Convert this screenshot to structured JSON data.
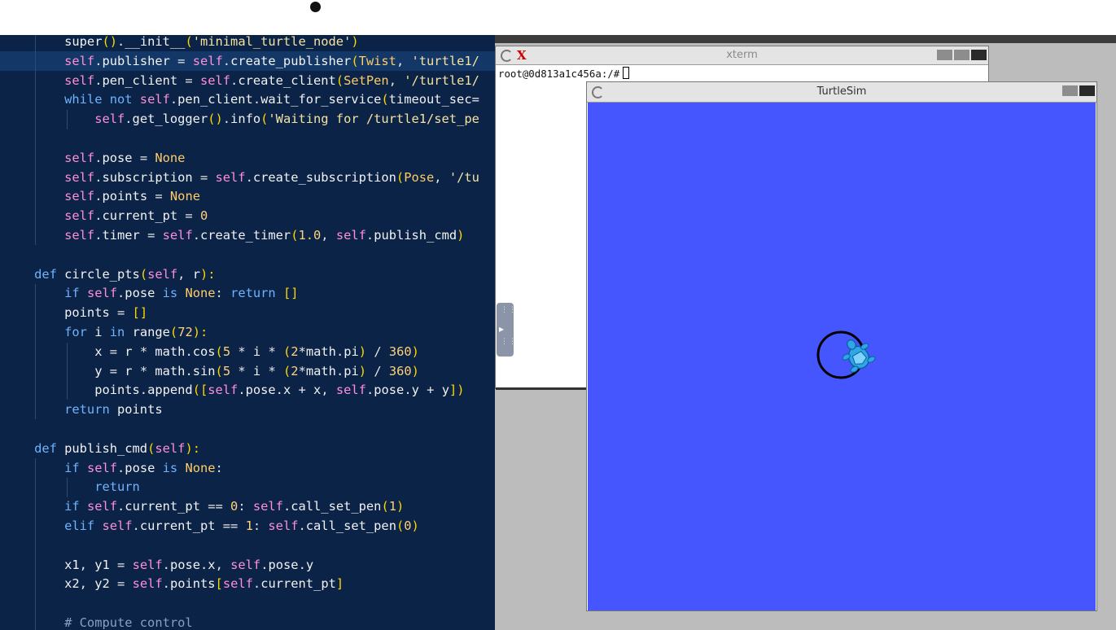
{
  "editor": {
    "lines": [
      [
        [
          "fn",
          "        super"
        ],
        [
          "br",
          "()"
        ],
        [
          "op",
          "."
        ],
        [
          "fn",
          "__init__"
        ],
        [
          "br",
          "("
        ],
        [
          "str",
          "'minimal_turtle_node'"
        ],
        [
          "br",
          ")"
        ]
      ],
      [
        [
          "self",
          "        self"
        ],
        [
          "op",
          "."
        ],
        [
          "fn",
          "publisher "
        ],
        [
          "op",
          "= "
        ],
        [
          "self",
          "self"
        ],
        [
          "op",
          "."
        ],
        [
          "fn",
          "create_publisher"
        ],
        [
          "br",
          "("
        ],
        [
          "cls",
          "Twist"
        ],
        [
          "op",
          ", "
        ],
        [
          "str",
          "'turtle1/"
        ]
      ],
      [
        [
          "self",
          "        self"
        ],
        [
          "op",
          "."
        ],
        [
          "fn",
          "pen_client "
        ],
        [
          "op",
          "= "
        ],
        [
          "self",
          "self"
        ],
        [
          "op",
          "."
        ],
        [
          "fn",
          "create_client"
        ],
        [
          "br",
          "("
        ],
        [
          "cls",
          "SetPen"
        ],
        [
          "op",
          ", "
        ],
        [
          "str",
          "'/turtle1/"
        ]
      ],
      [
        [
          "kw",
          "        while not "
        ],
        [
          "self",
          "self"
        ],
        [
          "op",
          "."
        ],
        [
          "fn",
          "pen_client"
        ],
        [
          "op",
          "."
        ],
        [
          "fn",
          "wait_for_service"
        ],
        [
          "br",
          "("
        ],
        [
          "fn",
          "timeout_sec="
        ]
      ],
      [
        [
          "self",
          "            self"
        ],
        [
          "op",
          "."
        ],
        [
          "fn",
          "get_logger"
        ],
        [
          "br",
          "()"
        ],
        [
          "op",
          "."
        ],
        [
          "fn",
          "info"
        ],
        [
          "br",
          "("
        ],
        [
          "str",
          "'Waiting for /turtle1/set_pe"
        ]
      ],
      [
        [
          "op",
          ""
        ]
      ],
      [
        [
          "self",
          "        self"
        ],
        [
          "op",
          "."
        ],
        [
          "fn",
          "pose "
        ],
        [
          "op",
          "= "
        ],
        [
          "cls",
          "None"
        ]
      ],
      [
        [
          "self",
          "        self"
        ],
        [
          "op",
          "."
        ],
        [
          "fn",
          "subscription "
        ],
        [
          "op",
          "= "
        ],
        [
          "self",
          "self"
        ],
        [
          "op",
          "."
        ],
        [
          "fn",
          "create_subscription"
        ],
        [
          "br",
          "("
        ],
        [
          "cls",
          "Pose"
        ],
        [
          "op",
          ", "
        ],
        [
          "str",
          "'/tu"
        ]
      ],
      [
        [
          "self",
          "        self"
        ],
        [
          "op",
          "."
        ],
        [
          "fn",
          "points "
        ],
        [
          "op",
          "= "
        ],
        [
          "cls",
          "None"
        ]
      ],
      [
        [
          "self",
          "        self"
        ],
        [
          "op",
          "."
        ],
        [
          "fn",
          "current_pt "
        ],
        [
          "op",
          "= "
        ],
        [
          "num",
          "0"
        ]
      ],
      [
        [
          "self",
          "        self"
        ],
        [
          "op",
          "."
        ],
        [
          "fn",
          "timer "
        ],
        [
          "op",
          "= "
        ],
        [
          "self",
          "self"
        ],
        [
          "op",
          "."
        ],
        [
          "fn",
          "create_timer"
        ],
        [
          "br",
          "("
        ],
        [
          "num",
          "1.0"
        ],
        [
          "op",
          ", "
        ],
        [
          "self",
          "self"
        ],
        [
          "op",
          "."
        ],
        [
          "fn",
          "publish_cmd"
        ],
        [
          "br",
          ")"
        ]
      ],
      [
        [
          "op",
          ""
        ]
      ],
      [
        [
          "kw",
          "    def "
        ],
        [
          "fn",
          "circle_pts"
        ],
        [
          "br",
          "("
        ],
        [
          "self",
          "self"
        ],
        [
          "op",
          ", "
        ],
        [
          "fn",
          "r"
        ],
        [
          "br",
          "):"
        ]
      ],
      [
        [
          "kw",
          "        if "
        ],
        [
          "self",
          "self"
        ],
        [
          "op",
          "."
        ],
        [
          "fn",
          "pose "
        ],
        [
          "kw",
          "is "
        ],
        [
          "cls",
          "None"
        ],
        [
          "op",
          ": "
        ],
        [
          "kw",
          "return "
        ],
        [
          "br",
          "[]"
        ]
      ],
      [
        [
          "fn",
          "        points "
        ],
        [
          "op",
          "= "
        ],
        [
          "br",
          "[]"
        ]
      ],
      [
        [
          "kw",
          "        for "
        ],
        [
          "fn",
          "i "
        ],
        [
          "kw",
          "in "
        ],
        [
          "fn",
          "range"
        ],
        [
          "br",
          "("
        ],
        [
          "num",
          "72"
        ],
        [
          "br",
          "):"
        ]
      ],
      [
        [
          "fn",
          "            x "
        ],
        [
          "op",
          "= "
        ],
        [
          "fn",
          "r "
        ],
        [
          "op",
          "* "
        ],
        [
          "fn",
          "math"
        ],
        [
          "op",
          "."
        ],
        [
          "fn",
          "cos"
        ],
        [
          "br",
          "("
        ],
        [
          "num",
          "5 "
        ],
        [
          "op",
          "* "
        ],
        [
          "fn",
          "i "
        ],
        [
          "op",
          "* "
        ],
        [
          "br",
          "("
        ],
        [
          "num",
          "2"
        ],
        [
          "op",
          "*"
        ],
        [
          "fn",
          "math"
        ],
        [
          "op",
          "."
        ],
        [
          "fn",
          "pi"
        ],
        [
          "br",
          ")"
        ],
        [
          "op",
          " / "
        ],
        [
          "num",
          "360"
        ],
        [
          "br",
          ")"
        ]
      ],
      [
        [
          "fn",
          "            y "
        ],
        [
          "op",
          "= "
        ],
        [
          "fn",
          "r "
        ],
        [
          "op",
          "* "
        ],
        [
          "fn",
          "math"
        ],
        [
          "op",
          "."
        ],
        [
          "fn",
          "sin"
        ],
        [
          "br",
          "("
        ],
        [
          "num",
          "5 "
        ],
        [
          "op",
          "* "
        ],
        [
          "fn",
          "i "
        ],
        [
          "op",
          "* "
        ],
        [
          "br",
          "("
        ],
        [
          "num",
          "2"
        ],
        [
          "op",
          "*"
        ],
        [
          "fn",
          "math"
        ],
        [
          "op",
          "."
        ],
        [
          "fn",
          "pi"
        ],
        [
          "br",
          ")"
        ],
        [
          "op",
          " / "
        ],
        [
          "num",
          "360"
        ],
        [
          "br",
          ")"
        ]
      ],
      [
        [
          "fn",
          "            points"
        ],
        [
          "op",
          "."
        ],
        [
          "fn",
          "append"
        ],
        [
          "br",
          "(["
        ],
        [
          "self",
          "self"
        ],
        [
          "op",
          "."
        ],
        [
          "fn",
          "pose"
        ],
        [
          "op",
          "."
        ],
        [
          "fn",
          "x "
        ],
        [
          "op",
          "+ "
        ],
        [
          "fn",
          "x"
        ],
        [
          "op",
          ", "
        ],
        [
          "self",
          "self"
        ],
        [
          "op",
          "."
        ],
        [
          "fn",
          "pose"
        ],
        [
          "op",
          "."
        ],
        [
          "fn",
          "y "
        ],
        [
          "op",
          "+ "
        ],
        [
          "fn",
          "y"
        ],
        [
          "br",
          "])"
        ]
      ],
      [
        [
          "kw",
          "        return "
        ],
        [
          "fn",
          "points"
        ]
      ],
      [
        [
          "op",
          ""
        ]
      ],
      [
        [
          "kw",
          "    def "
        ],
        [
          "fn",
          "publish_cmd"
        ],
        [
          "br",
          "("
        ],
        [
          "self",
          "self"
        ],
        [
          "br",
          "):"
        ]
      ],
      [
        [
          "kw",
          "        if "
        ],
        [
          "self",
          "self"
        ],
        [
          "op",
          "."
        ],
        [
          "fn",
          "pose "
        ],
        [
          "kw",
          "is "
        ],
        [
          "cls",
          "None"
        ],
        [
          "op",
          ":"
        ]
      ],
      [
        [
          "kw",
          "            return"
        ]
      ],
      [
        [
          "kw",
          "        if "
        ],
        [
          "self",
          "self"
        ],
        [
          "op",
          "."
        ],
        [
          "fn",
          "current_pt "
        ],
        [
          "op",
          "== "
        ],
        [
          "num",
          "0"
        ],
        [
          "op",
          ": "
        ],
        [
          "self",
          "self"
        ],
        [
          "op",
          "."
        ],
        [
          "fn",
          "call_set_pen"
        ],
        [
          "br",
          "("
        ],
        [
          "num",
          "1"
        ],
        [
          "br",
          ")"
        ]
      ],
      [
        [
          "kw",
          "        elif "
        ],
        [
          "self",
          "self"
        ],
        [
          "op",
          "."
        ],
        [
          "fn",
          "current_pt "
        ],
        [
          "op",
          "== "
        ],
        [
          "num",
          "1"
        ],
        [
          "op",
          ": "
        ],
        [
          "self",
          "self"
        ],
        [
          "op",
          "."
        ],
        [
          "fn",
          "call_set_pen"
        ],
        [
          "br",
          "("
        ],
        [
          "num",
          "0"
        ],
        [
          "br",
          ")"
        ]
      ],
      [
        [
          "op",
          ""
        ]
      ],
      [
        [
          "fn",
          "        x1"
        ],
        [
          "op",
          ", "
        ],
        [
          "fn",
          "y1 "
        ],
        [
          "op",
          "= "
        ],
        [
          "self",
          "self"
        ],
        [
          "op",
          "."
        ],
        [
          "fn",
          "pose"
        ],
        [
          "op",
          "."
        ],
        [
          "fn",
          "x"
        ],
        [
          "op",
          ", "
        ],
        [
          "self",
          "self"
        ],
        [
          "op",
          "."
        ],
        [
          "fn",
          "pose"
        ],
        [
          "op",
          "."
        ],
        [
          "fn",
          "y"
        ]
      ],
      [
        [
          "fn",
          "        x2"
        ],
        [
          "op",
          ", "
        ],
        [
          "fn",
          "y2 "
        ],
        [
          "op",
          "= "
        ],
        [
          "self",
          "self"
        ],
        [
          "op",
          "."
        ],
        [
          "fn",
          "points"
        ],
        [
          "br",
          "["
        ],
        [
          "self",
          "self"
        ],
        [
          "op",
          "."
        ],
        [
          "fn",
          "current_pt"
        ],
        [
          "br",
          "]"
        ]
      ],
      [
        [
          "op",
          ""
        ]
      ],
      [
        [
          "cmt",
          "        # Compute control"
        ]
      ]
    ]
  },
  "xterm": {
    "title": "xterm",
    "logo": "X",
    "prompt": "root@0d813a1c456a:/#"
  },
  "turtlesim": {
    "title": "TurtleSim",
    "background_color": "#4556ff",
    "pen_color": "#000000",
    "turtle_color": "#2ea6e8"
  }
}
